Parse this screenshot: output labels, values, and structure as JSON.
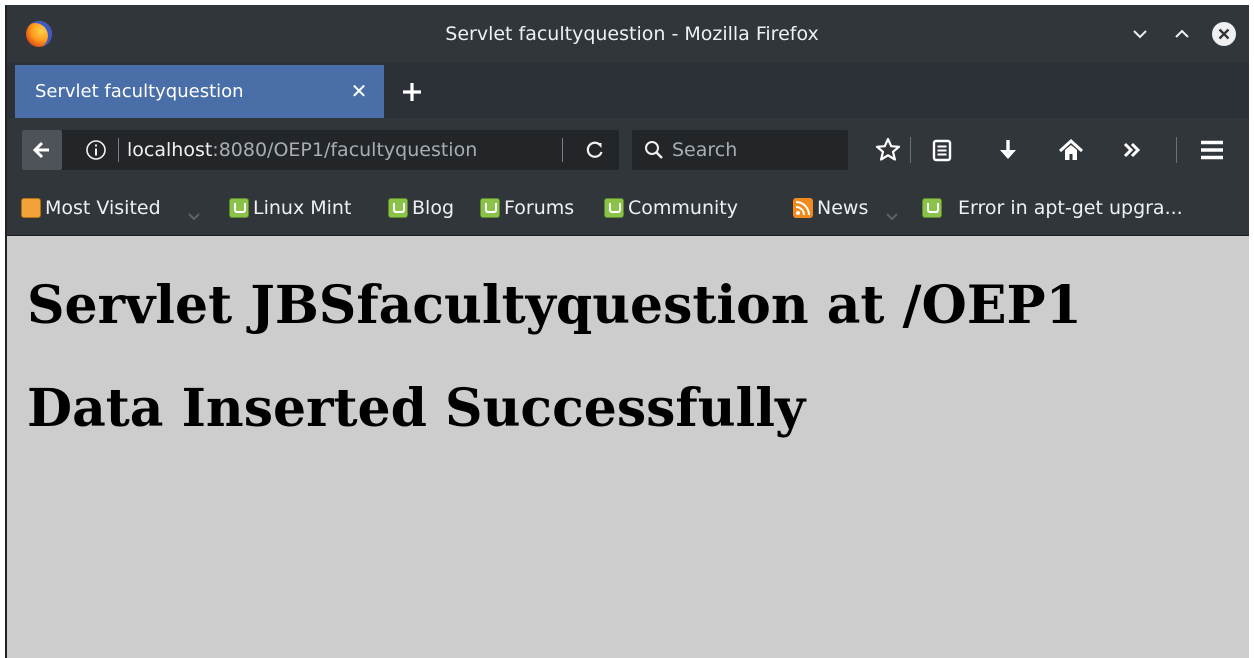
{
  "window": {
    "title": "Servlet facultyquestion - Mozilla Firefox",
    "logo_icon": "firefox-logo-icon",
    "controls": [
      "minimize-icon",
      "maximize-icon",
      "close-icon"
    ]
  },
  "tabs": [
    {
      "label": "Servlet facultyquestion",
      "close_glyph": "✕",
      "active": true
    }
  ],
  "new_tab_icon": "plus-icon",
  "navbar": {
    "url_host": "localhost",
    "url_path": ":8080/OEP1/facultyquestion",
    "search_placeholder": "Search",
    "icons": [
      "back-icon",
      "info-icon",
      "reload-icon",
      "search-icon",
      "star-icon",
      "reading-list-icon",
      "download-icon",
      "home-icon",
      "overflow-icon",
      "menu-icon"
    ]
  },
  "bookmarks": [
    {
      "label": "Most Visited",
      "icon": "folder-icon",
      "dropdown": true
    },
    {
      "label": "Linux Mint",
      "icon": "linux-mint-icon"
    },
    {
      "label": "Blog",
      "icon": "linux-mint-icon"
    },
    {
      "label": "Forums",
      "icon": "linux-mint-icon"
    },
    {
      "label": "Community",
      "icon": "linux-mint-icon"
    },
    {
      "label": "News",
      "icon": "rss-icon",
      "dropdown": true
    },
    {
      "label": "Error in apt-get upgra...",
      "icon": "linux-mint-icon"
    }
  ],
  "page": {
    "heading": "Servlet JBSfacultyquestion at /OEP1",
    "message": "Data Inserted Successfully"
  },
  "colors": {
    "chrome_dark": "#31363b",
    "tabstrip": "#2b3136",
    "active_tab": "#4a6fa8",
    "content_bg": "#cdcdcd",
    "text_light": "#eff0f1"
  }
}
